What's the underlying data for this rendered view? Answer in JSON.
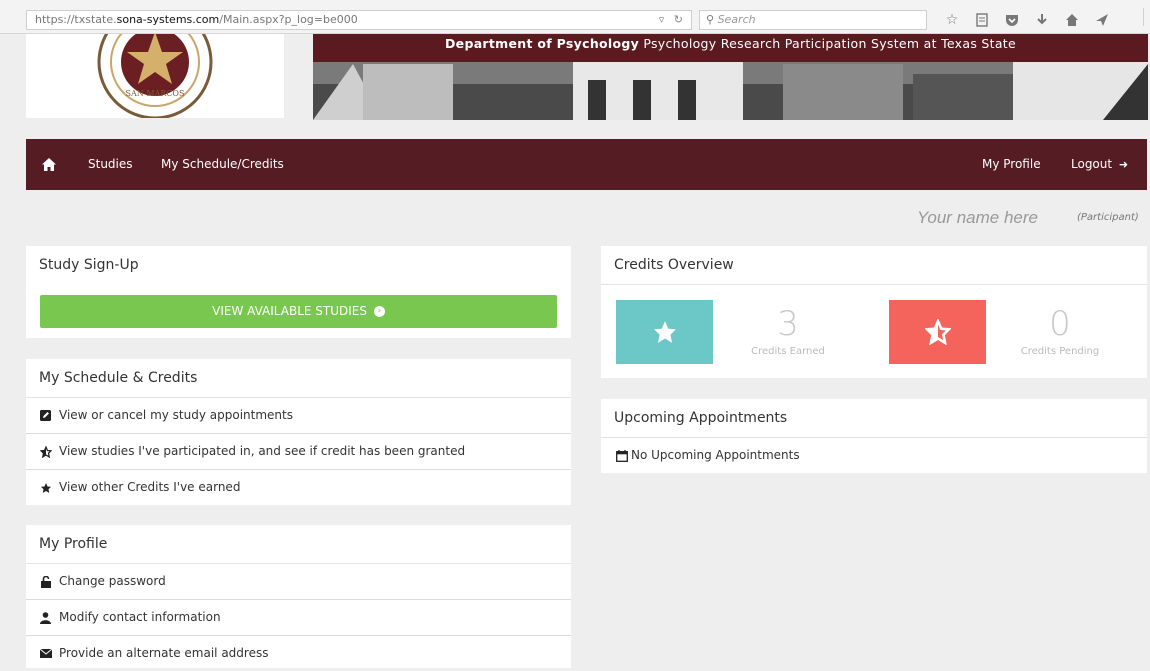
{
  "browser": {
    "url_prefix": "https://txstate.",
    "url_host": "sona-systems.com",
    "url_path": "/Main.aspx?p_log=be000",
    "search_placeholder": "Search"
  },
  "header": {
    "banner_bold": "Department of Psychology",
    "banner_text": " Psychology Research Participation System at Texas State",
    "logo_text": "SAN MARCOS"
  },
  "nav": {
    "studies": "Studies",
    "schedule": "My Schedule/Credits",
    "profile": "My Profile",
    "logout": "Logout"
  },
  "user": {
    "name": "Your name here",
    "role": "(Participant)"
  },
  "signup": {
    "title": "Study Sign-Up",
    "button": "VIEW AVAILABLE STUDIES"
  },
  "schedule": {
    "title": "My Schedule & Credits",
    "items": [
      {
        "label": "View or cancel my study appointments",
        "icon": "edit-icon"
      },
      {
        "label": "View studies I've participated in, and see if credit has been granted",
        "icon": "star-half-icon"
      },
      {
        "label": "View other Credits I've earned",
        "icon": "star-icon"
      }
    ]
  },
  "profile": {
    "title": "My Profile",
    "items": [
      {
        "label": "Change password",
        "icon": "unlock-icon"
      },
      {
        "label": "Modify contact information",
        "icon": "user-icon"
      },
      {
        "label": "Provide an alternate email address",
        "icon": "envelope-icon"
      }
    ]
  },
  "credits": {
    "title": "Credits Overview",
    "earned_value": "3",
    "earned_label": "Credits Earned",
    "pending_value": "0",
    "pending_label": "Credits Pending"
  },
  "appointments": {
    "title": "Upcoming Appointments",
    "empty": "No Upcoming Appointments"
  },
  "colors": {
    "nav": "#561c23",
    "green": "#7ac74f",
    "teal": "#6cc8c6",
    "red": "#f4645d"
  }
}
